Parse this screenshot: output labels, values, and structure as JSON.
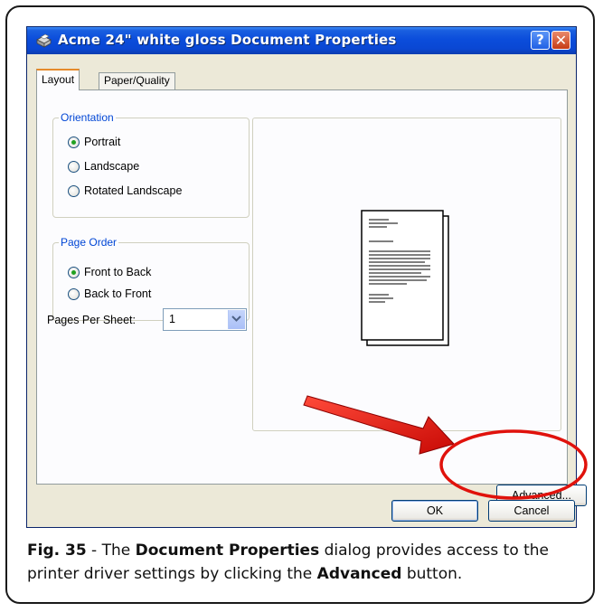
{
  "window": {
    "title": "Acme 24\" white gloss Document Properties",
    "help_glyph": "?",
    "close_glyph": "✕"
  },
  "tabs": [
    {
      "label": "Layout",
      "active": true
    },
    {
      "label": "Paper/Quality",
      "active": false
    }
  ],
  "orientation": {
    "legend": "Orientation",
    "options": [
      "Portrait",
      "Landscape",
      "Rotated Landscape"
    ],
    "selected": "Portrait"
  },
  "page_order": {
    "legend": "Page Order",
    "options": [
      "Front to Back",
      "Back to Front"
    ],
    "selected": "Front to Back"
  },
  "pages_per_sheet": {
    "label": "Pages Per Sheet:",
    "value": "1"
  },
  "buttons": {
    "advanced": "Advanced...",
    "ok": "OK",
    "cancel": "Cancel"
  },
  "caption": {
    "fig": "Fig. 35",
    "sep": " - The ",
    "strong1": "Document Properties",
    "mid": " dialog provides access to the printer driver settings by clicking the ",
    "strong2": "Advanced",
    "end": " button."
  },
  "colors": {
    "titlebar": "#0a47d3",
    "dialog_bg": "#ece9d8",
    "group_legend": "#0046d5",
    "highlight_arrow": "#e0120c"
  },
  "icons": {
    "title": "printer-icon",
    "help": "help-icon",
    "close": "close-icon",
    "dropdown": "chevron-down-icon"
  }
}
